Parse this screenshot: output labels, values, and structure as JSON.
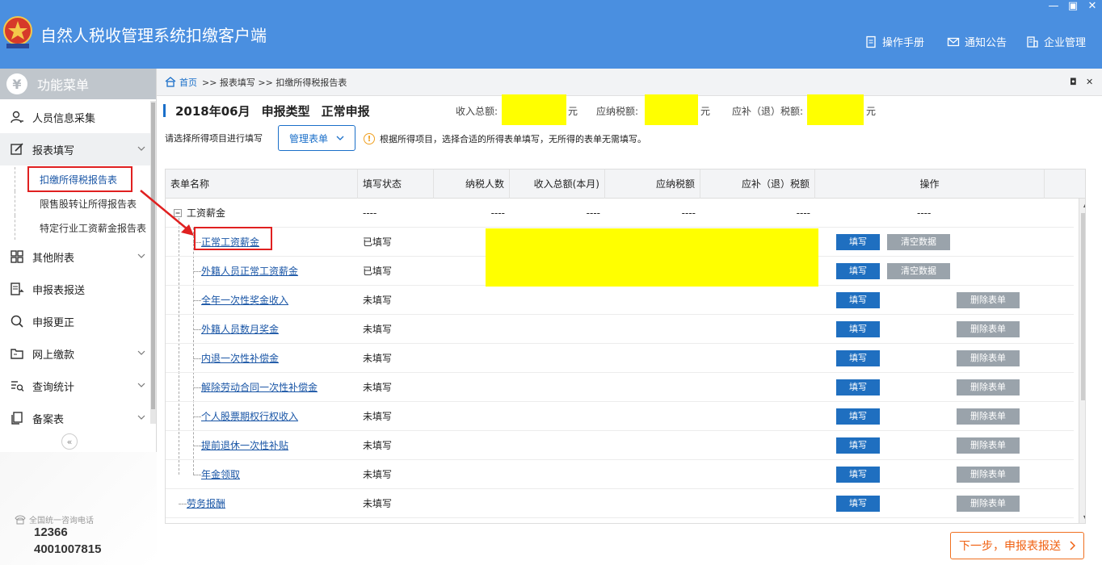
{
  "app": {
    "title": "自然人税收管理系统扣缴客户端",
    "header_links": [
      "操作手册",
      "通知公告",
      "企业管理"
    ]
  },
  "sidebar": {
    "title": "功能菜单",
    "items": [
      {
        "label": "人员信息采集"
      },
      {
        "label": "报表填写"
      },
      {
        "label": "其他附表"
      },
      {
        "label": "申报表报送"
      },
      {
        "label": "申报更正"
      },
      {
        "label": "网上缴款"
      },
      {
        "label": "查询统计"
      },
      {
        "label": "备案表"
      }
    ],
    "sub_items": [
      "扣缴所得税报告表",
      "限售股转让所得报告表",
      "特定行业工资薪金报告表"
    ],
    "collapse_glyph": "«",
    "hotline_label": "全国统一咨询电话",
    "hotline_numbers": [
      "12366",
      "4001007815"
    ]
  },
  "breadcrumb": {
    "home": "首页",
    "path": ">> 报表填写 >> 扣缴所得税报告表"
  },
  "report": {
    "period": "2018年06月",
    "type_label": "申报类型",
    "type_value": "正常申报",
    "income_label": "收入总额:",
    "tax_label": "应纳税额:",
    "refund_label": "应补（退）税额:",
    "unit": "元"
  },
  "hint": {
    "prompt": "请选择所得项目进行填写",
    "manage_button": "管理表单",
    "tip": "根据所得项目，选择合适的所得表单填写，无所得的表单无需填写。"
  },
  "table": {
    "headers": [
      "表单名称",
      "填写状态",
      "纳税人数",
      "收入总额(本月)",
      "应纳税额",
      "应补（退）税额",
      "操作"
    ],
    "group_label": "工资薪金",
    "group_status": "----",
    "group_cells": [
      "----",
      "----",
      "----",
      "----",
      "----"
    ],
    "rows": [
      {
        "name": "正常工资薪金",
        "status": "已填写",
        "action_primary": "填写",
        "action_secondary": "清空数据"
      },
      {
        "name": "外籍人员正常工资薪金",
        "status": "已填写",
        "action_primary": "填写",
        "action_secondary": "清空数据"
      },
      {
        "name": "全年一次性奖金收入",
        "status": "未填写",
        "action_primary": "填写",
        "action_secondary": "删除表单"
      },
      {
        "name": "外籍人员数月奖金",
        "status": "未填写",
        "action_primary": "填写",
        "action_secondary": "删除表单"
      },
      {
        "name": "内退一次性补偿金",
        "status": "未填写",
        "action_primary": "填写",
        "action_secondary": "删除表单"
      },
      {
        "name": "解除劳动合同一次性补偿金",
        "status": "未填写",
        "action_primary": "填写",
        "action_secondary": "删除表单"
      },
      {
        "name": "个人股票期权行权收入",
        "status": "未填写",
        "action_primary": "填写",
        "action_secondary": "删除表单"
      },
      {
        "name": "提前退休一次性补贴",
        "status": "未填写",
        "action_primary": "填写",
        "action_secondary": "删除表单"
      },
      {
        "name": "年金领取",
        "status": "未填写",
        "action_primary": "填写",
        "action_secondary": "删除表单"
      },
      {
        "name": "劳务报酬",
        "status": "未填写",
        "action_primary": "填写",
        "action_secondary": "删除表单"
      }
    ]
  },
  "next_button": "下一步，申报表报送",
  "colors": {
    "header_bg": "#4a8fe0",
    "primary": "#1f6fc0",
    "gray_button": "#9aa3ab",
    "highlight": "#ffff00",
    "annotation": "#e02020",
    "next_button": "#f06010"
  }
}
